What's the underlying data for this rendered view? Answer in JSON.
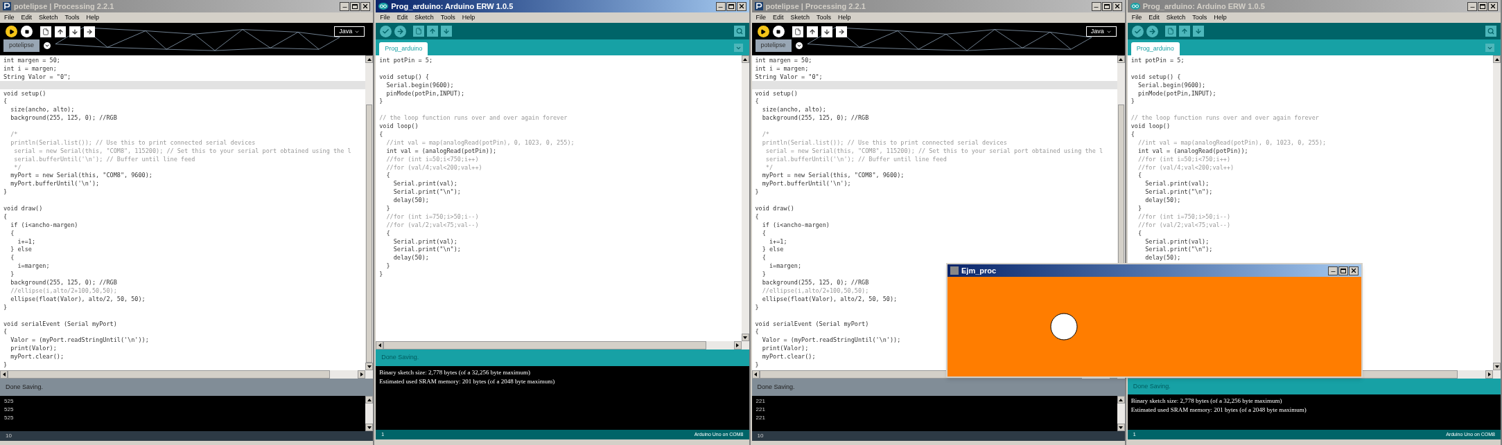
{
  "windows": [
    {
      "kind": "processing",
      "title": "potelipse | Processing 2.2.1",
      "active": false,
      "menu": [
        "File",
        "Edit",
        "Sketch",
        "Tools",
        "Help"
      ],
      "mode": "Java",
      "tab": "potelipse",
      "code": [
        {
          "kind": "code",
          "text": "int margen = 50;"
        },
        {
          "kind": "code",
          "text": "int i = margen;"
        },
        {
          "kind": "code",
          "text": "String Valor = \"0\";"
        },
        {
          "kind": "current"
        },
        {
          "kind": "code",
          "text": "void setup()"
        },
        {
          "kind": "code",
          "text": "{"
        },
        {
          "kind": "code",
          "text": "  size(ancho, alto);"
        },
        {
          "kind": "code",
          "text": "  background(255, 125, 0); //RGB"
        },
        {
          "kind": "blank"
        },
        {
          "kind": "comment",
          "text": "  /*"
        },
        {
          "kind": "comment",
          "text": "  println(Serial.list()); // Use this to print connected serial devices"
        },
        {
          "kind": "comment",
          "text": "   serial = new Serial(this, \"COM8\", 115200); // Set this to your serial port obtained using the l"
        },
        {
          "kind": "comment",
          "text": "   serial.bufferUntil('\\n'); // Buffer until line feed"
        },
        {
          "kind": "comment",
          "text": "   */"
        },
        {
          "kind": "code",
          "text": "  myPort = new Serial(this, \"COM8\", 9600);"
        },
        {
          "kind": "code",
          "text": "  myPort.bufferUntil('\\n');"
        },
        {
          "kind": "code",
          "text": "}"
        },
        {
          "kind": "blank"
        },
        {
          "kind": "code",
          "text": "void draw()"
        },
        {
          "kind": "code",
          "text": "{"
        },
        {
          "kind": "code",
          "text": "  if (i<ancho-margen)"
        },
        {
          "kind": "code",
          "text": "  {"
        },
        {
          "kind": "code",
          "text": "    i+=1;"
        },
        {
          "kind": "code",
          "text": "  } else"
        },
        {
          "kind": "code",
          "text": "  {"
        },
        {
          "kind": "code",
          "text": "    i=margen;"
        },
        {
          "kind": "code",
          "text": "  }"
        },
        {
          "kind": "code",
          "text": "  background(255, 125, 0); //RGB"
        },
        {
          "kind": "comment",
          "text": "  //ellipse(i,alto/2+100,50,50);"
        },
        {
          "kind": "code",
          "text": "  ellipse(float(Valor), alto/2, 50, 50);"
        },
        {
          "kind": "code",
          "text": "}"
        },
        {
          "kind": "blank"
        },
        {
          "kind": "code",
          "text": "void serialEvent (Serial myPort)"
        },
        {
          "kind": "code",
          "text": "{"
        },
        {
          "kind": "code",
          "text": "  Valor = (myPort.readStringUntil('\\n'));"
        },
        {
          "kind": "code",
          "text": "  print(Valor);"
        },
        {
          "kind": "code",
          "text": "  myPort.clear();"
        },
        {
          "kind": "code",
          "text": "}"
        }
      ],
      "status": "Done Saving.",
      "console": [
        "525",
        "525",
        "525"
      ],
      "line_number": "10"
    },
    {
      "kind": "arduino",
      "title": "Prog_arduino: Arduino ERW 1.0.5",
      "active": true,
      "menu": [
        "File",
        "Edit",
        "Sketch",
        "Tools",
        "Help"
      ],
      "tab": "Prog_arduino",
      "code": [
        {
          "kind": "code",
          "text": "int potPin = 5;"
        },
        {
          "kind": "blank"
        },
        {
          "kind": "code",
          "text": "void setup() {"
        },
        {
          "kind": "code",
          "text": "  Serial.begin(9600);"
        },
        {
          "kind": "code",
          "text": "  pinMode(potPin,INPUT);"
        },
        {
          "kind": "code",
          "text": "}"
        },
        {
          "kind": "blank"
        },
        {
          "kind": "comment",
          "text": "// the loop function runs over and over again forever"
        },
        {
          "kind": "code",
          "text": "void loop()"
        },
        {
          "kind": "code",
          "text": "{"
        },
        {
          "kind": "comment",
          "text": "  //int val = map(analogRead(potPin), 0, 1023, 0, 255);"
        },
        {
          "kind": "code",
          "text": "  int val = (analogRead(potPin));"
        },
        {
          "kind": "comment",
          "text": "  //for (int i=50;i<750;i++)"
        },
        {
          "kind": "comment",
          "text": "  //for (val/4;val<200;val++)"
        },
        {
          "kind": "code",
          "text": "  {"
        },
        {
          "kind": "code",
          "text": "    Serial.print(val);"
        },
        {
          "kind": "code",
          "text": "    Serial.print(\"\\n\");"
        },
        {
          "kind": "code",
          "text": "    delay(50);"
        },
        {
          "kind": "code",
          "text": "  }"
        },
        {
          "kind": "comment",
          "text": "  //for (int i=750;i>50;i--)"
        },
        {
          "kind": "comment",
          "text": "  //for (val/2;val<75;val--)"
        },
        {
          "kind": "code",
          "text": "  {"
        },
        {
          "kind": "code",
          "text": "    Serial.print(val);"
        },
        {
          "kind": "code",
          "text": "    Serial.print(\"\\n\");"
        },
        {
          "kind": "code",
          "text": "    delay(50);"
        },
        {
          "kind": "code",
          "text": "  }"
        },
        {
          "kind": "code",
          "text": "}"
        }
      ],
      "status": "Done Saving.",
      "console": [
        "Binary sketch size: 2,778 bytes (of a 32,256 byte maximum)",
        "Estimated used SRAM memory: 201 bytes (of a 2048 byte maximum)"
      ],
      "line_number": "1",
      "board": "Arduino Uno on COM8"
    },
    {
      "kind": "processing",
      "title": "potelipse | Processing 2.2.1",
      "active": false,
      "menu": [
        "File",
        "Edit",
        "Sketch",
        "Tools",
        "Help"
      ],
      "mode": "Java",
      "tab": "potelipse",
      "code": [
        {
          "kind": "code",
          "text": "int margen = 50;"
        },
        {
          "kind": "code",
          "text": "int i = margen;"
        },
        {
          "kind": "code",
          "text": "String Valor = \"0\";"
        },
        {
          "kind": "current"
        },
        {
          "kind": "code",
          "text": "void setup()"
        },
        {
          "kind": "code",
          "text": "{"
        },
        {
          "kind": "code",
          "text": "  size(ancho, alto);"
        },
        {
          "kind": "code",
          "text": "  background(255, 125, 0); //RGB"
        },
        {
          "kind": "blank"
        },
        {
          "kind": "comment",
          "text": "  /*"
        },
        {
          "kind": "comment",
          "text": "  println(Serial.list()); // Use this to print connected serial devices"
        },
        {
          "kind": "comment",
          "text": "   serial = new Serial(this, \"COM8\", 115200); // Set this to your serial port obtained using the l"
        },
        {
          "kind": "comment",
          "text": "   serial.bufferUntil('\\n'); // Buffer until line feed"
        },
        {
          "kind": "comment",
          "text": "   */"
        },
        {
          "kind": "code",
          "text": "  myPort = new Serial(this, \"COM8\", 9600);"
        },
        {
          "kind": "code",
          "text": "  myPort.bufferUntil('\\n');"
        },
        {
          "kind": "code",
          "text": "}"
        },
        {
          "kind": "blank"
        },
        {
          "kind": "code",
          "text": "void draw()"
        },
        {
          "kind": "code",
          "text": "{"
        },
        {
          "kind": "code",
          "text": "  if (i<ancho-margen)"
        },
        {
          "kind": "code",
          "text": "  {"
        },
        {
          "kind": "code",
          "text": "    i+=1;"
        },
        {
          "kind": "code",
          "text": "  } else"
        },
        {
          "kind": "code",
          "text": "  {"
        },
        {
          "kind": "code",
          "text": "    i=margen;"
        },
        {
          "kind": "code",
          "text": "  }"
        },
        {
          "kind": "code",
          "text": "  background(255, 125, 0); //RGB"
        },
        {
          "kind": "comment",
          "text": "  //ellipse(i,alto/2+100,50,50);"
        },
        {
          "kind": "code",
          "text": "  ellipse(float(Valor), alto/2, 50, 50);"
        },
        {
          "kind": "code",
          "text": "}"
        },
        {
          "kind": "blank"
        },
        {
          "kind": "code",
          "text": "void serialEvent (Serial myPort)"
        },
        {
          "kind": "code",
          "text": "{"
        },
        {
          "kind": "code",
          "text": "  Valor = (myPort.readStringUntil('\\n'));"
        },
        {
          "kind": "code",
          "text": "  print(Valor);"
        },
        {
          "kind": "code",
          "text": "  myPort.clear();"
        },
        {
          "kind": "code",
          "text": "}"
        }
      ],
      "status": "Done Saving.",
      "console": [
        "221",
        "221",
        "221"
      ],
      "line_number": "10"
    },
    {
      "kind": "arduino",
      "title": "Prog_arduino: Arduino ERW 1.0.5",
      "active": false,
      "menu": [
        "File",
        "Edit",
        "Sketch",
        "Tools",
        "Help"
      ],
      "tab": "Prog_arduino",
      "code": [
        {
          "kind": "code",
          "text": "int potPin = 5;"
        },
        {
          "kind": "blank"
        },
        {
          "kind": "code",
          "text": "void setup() {"
        },
        {
          "kind": "code",
          "text": "  Serial.begin(9600);"
        },
        {
          "kind": "code",
          "text": "  pinMode(potPin,INPUT);"
        },
        {
          "kind": "code",
          "text": "}"
        },
        {
          "kind": "blank"
        },
        {
          "kind": "comment",
          "text": "// the loop function runs over and over again forever"
        },
        {
          "kind": "code",
          "text": "void loop()"
        },
        {
          "kind": "code",
          "text": "{"
        },
        {
          "kind": "comment",
          "text": "  //int val = map(analogRead(potPin), 0, 1023, 0, 255);"
        },
        {
          "kind": "code",
          "text": "  int val = (analogRead(potPin));"
        },
        {
          "kind": "comment",
          "text": "  //for (int i=50;i<750;i++)"
        },
        {
          "kind": "comment",
          "text": "  //for (val/4;val<200;val++)"
        },
        {
          "kind": "code",
          "text": "  {"
        },
        {
          "kind": "code",
          "text": "    Serial.print(val);"
        },
        {
          "kind": "code",
          "text": "    Serial.print(\"\\n\");"
        },
        {
          "kind": "code",
          "text": "    delay(50);"
        },
        {
          "kind": "code",
          "text": "  }"
        },
        {
          "kind": "comment",
          "text": "  //for (int i=750;i>50;i--)"
        },
        {
          "kind": "comment",
          "text": "  //for (val/2;val<75;val--)"
        },
        {
          "kind": "code",
          "text": "  {"
        },
        {
          "kind": "code",
          "text": "    Serial.print(val);"
        },
        {
          "kind": "code",
          "text": "    Serial.print(\"\\n\");"
        },
        {
          "kind": "code",
          "text": "    delay(50);"
        }
      ],
      "status": "Done Saving.",
      "console": [
        "Binary sketch size: 2,778 bytes (of a 32,256 byte maximum)",
        "Estimated used SRAM memory: 201 bytes (of a 2048 byte maximum)"
      ],
      "line_number": "1",
      "board": "Arduino Uno on COM8"
    }
  ],
  "overlay": {
    "title": "Ejm_proc"
  }
}
